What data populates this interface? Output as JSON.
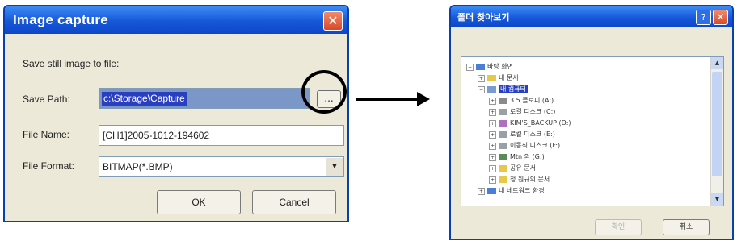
{
  "capture_dialog": {
    "title": "Image capture",
    "close_label": "✕",
    "intro": "Save still image to file:",
    "save_path_label": "Save Path:",
    "save_path_value": "c:\\Storage\\Capture",
    "browse_label": "...",
    "file_name_label": "File Name:",
    "file_name_value": "[CH1]2005-1012-194602",
    "file_format_label": "File Format:",
    "file_format_value": "BITMAP(*.BMP)",
    "ok_label": "OK",
    "cancel_label": "Cancel"
  },
  "folder_dialog": {
    "title": "폴더 찾아보기",
    "help_label": "?",
    "close_label": "✕",
    "tree": [
      {
        "label": "바탕 화면",
        "icon": "desktop-icon",
        "expander": "−"
      },
      {
        "label": "내 문서",
        "icon": "folder-icon",
        "expander": "+"
      },
      {
        "label": "내 컴퓨터",
        "icon": "computer-icon",
        "expander": "−",
        "selected": true
      },
      {
        "label": "3.5 플로피 (A:)",
        "icon": "floppy-icon",
        "expander": "+"
      },
      {
        "label": "로컬 디스크 (C:)",
        "icon": "drive-icon",
        "expander": "+"
      },
      {
        "label": "KIM'S_BACKUP (D:)",
        "icon": "cd-icon",
        "expander": "+"
      },
      {
        "label": "로컬 디스크 (E:)",
        "icon": "drive-icon",
        "expander": "+"
      },
      {
        "label": "이동식 디스크 (F:)",
        "icon": "drive-icon",
        "expander": "+"
      },
      {
        "label": "Mtn 의 (G:)",
        "icon": "network-drive-icon",
        "expander": "+"
      },
      {
        "label": "공유 문서",
        "icon": "folder-icon",
        "expander": "+"
      },
      {
        "label": "정 원규의 문서",
        "icon": "folder-icon",
        "expander": "+"
      },
      {
        "label": "내 네트워크 환경",
        "icon": "network-icon",
        "expander": "+"
      }
    ],
    "ok_label": "확인",
    "cancel_label": "취소"
  },
  "colors": {
    "title_bar": "#1657d8",
    "dialog_bg": "#ece9d8",
    "selection": "#2a3fc0",
    "close_button": "#d8482a"
  }
}
